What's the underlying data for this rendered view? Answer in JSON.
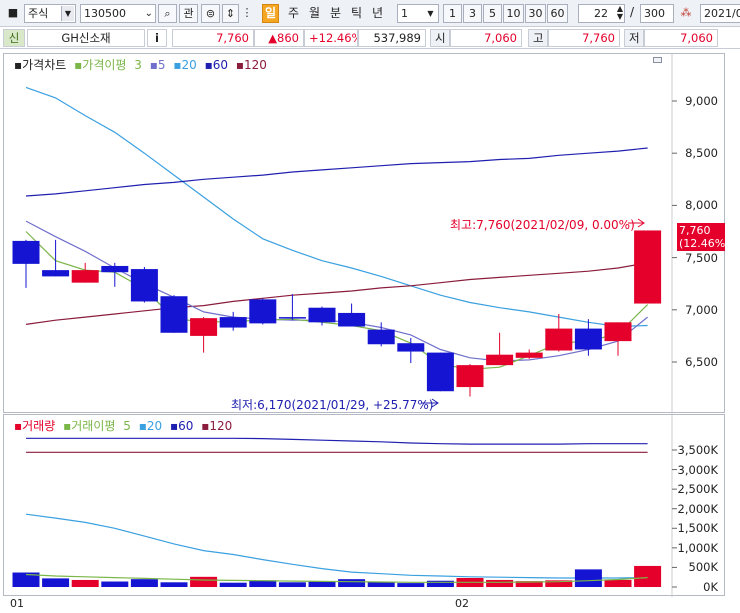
{
  "toolbar": {
    "market_type": "주식",
    "code": "130500",
    "btn_gwan": "관",
    "periods": [
      "일",
      "주",
      "월",
      "분",
      "틱",
      "년"
    ],
    "active_period": "일",
    "interval_value": "1",
    "interval_presets": [
      "1",
      "3",
      "5",
      "10",
      "30",
      "60"
    ],
    "view_count": "22",
    "total_count": "300",
    "slash": "/",
    "date": "2021/0"
  },
  "info": {
    "credit_badge": "신",
    "stock_name": "GH신소재",
    "info_button": "i",
    "price": "7,760",
    "change": "▲860",
    "change_rate": "+12.46%",
    "volume": "537,989",
    "open_label": "시",
    "open": "7,060",
    "high_label": "고",
    "high": "7,760",
    "low_label": "저",
    "low": "7,060"
  },
  "price_panel": {
    "legend_title": "가격차트",
    "ma_label": "가격이평",
    "ma_periods": [
      "3",
      "5",
      "20",
      "60",
      "120"
    ],
    "price_ticks": [
      "9,000",
      "8,500",
      "8,000",
      "7,500",
      "7,000",
      "6,500"
    ],
    "current_price_tag": "7,760",
    "current_rate_tag": "(12.46%)",
    "max_annotation": "최고:7,760(2021/02/09, 0.00%)",
    "min_annotation": "최저:6,170(2021/01/29, +25.77%)"
  },
  "volume_panel": {
    "legend_title": "거래량",
    "ma_label": "거래이평",
    "ma_periods": [
      "5",
      "20",
      "60",
      "120"
    ],
    "volume_ticks": [
      "3,500K",
      "3,000K",
      "2,500K",
      "2,000K",
      "1,500K",
      "1,000K",
      "500K",
      "0K"
    ]
  },
  "xaxis": {
    "labels": [
      "01",
      "02"
    ]
  },
  "colors": {
    "up": "#e4002b",
    "down": "#1414d2",
    "ma3": "#7ab648",
    "ma5": "#7070cc",
    "ma20": "#3aa0e0",
    "ma60": "#2020b0",
    "ma120": "#8a1c3c",
    "active_tab": "#f5a623"
  },
  "chart_data": {
    "type": "candlestick",
    "candles": [
      {
        "o": 7660,
        "h": 7670,
        "l": 7210,
        "c": 7440
      },
      {
        "o": 7380,
        "h": 7670,
        "l": 7320,
        "c": 7320
      },
      {
        "o": 7260,
        "h": 7450,
        "l": 7260,
        "c": 7380
      },
      {
        "o": 7420,
        "h": 7450,
        "l": 7220,
        "c": 7360
      },
      {
        "o": 7390,
        "h": 7410,
        "l": 7070,
        "c": 7080
      },
      {
        "o": 7130,
        "h": 7140,
        "l": 6780,
        "c": 6780
      },
      {
        "o": 6750,
        "h": 6930,
        "l": 6590,
        "c": 6920
      },
      {
        "o": 6930,
        "h": 6980,
        "l": 6800,
        "c": 6830
      },
      {
        "o": 7100,
        "h": 7110,
        "l": 6860,
        "c": 6870
      },
      {
        "o": 6930,
        "h": 7150,
        "l": 6900,
        "c": 6920
      },
      {
        "o": 7020,
        "h": 7030,
        "l": 6850,
        "c": 6880
      },
      {
        "o": 6970,
        "h": 7060,
        "l": 6840,
        "c": 6840
      },
      {
        "o": 6810,
        "h": 6880,
        "l": 6650,
        "c": 6670
      },
      {
        "o": 6680,
        "h": 6730,
        "l": 6490,
        "c": 6600
      },
      {
        "o": 6590,
        "h": 6590,
        "l": 6220,
        "c": 6220
      },
      {
        "o": 6260,
        "h": 6480,
        "l": 6170,
        "c": 6470
      },
      {
        "o": 6470,
        "h": 6780,
        "l": 6470,
        "c": 6570
      },
      {
        "o": 6540,
        "h": 6620,
        "l": 6530,
        "c": 6590
      },
      {
        "o": 6610,
        "h": 6960,
        "l": 6600,
        "c": 6820
      },
      {
        "o": 6820,
        "h": 6910,
        "l": 6560,
        "c": 6620
      },
      {
        "o": 6700,
        "h": 6880,
        "l": 6560,
        "c": 6880
      },
      {
        "o": 7060,
        "h": 7760,
        "l": 7060,
        "c": 7760
      }
    ],
    "volume": [
      370,
      220,
      180,
      140,
      200,
      120,
      260,
      110,
      170,
      120,
      140,
      200,
      130,
      100,
      160,
      230,
      180,
      150,
      170,
      450,
      180,
      537.989
    ],
    "ma3": [
      7750,
      7470,
      7380,
      7360,
      7200,
      6920,
      6880,
      6890,
      6900,
      6910,
      6880,
      6850,
      6800,
      6680,
      6480,
      6430,
      6450,
      6560,
      6680,
      6700,
      6770,
      7050
    ],
    "ma5": [
      7850,
      7700,
      7560,
      7400,
      7250,
      7120,
      6980,
      6930,
      6910,
      6900,
      6900,
      6880,
      6830,
      6760,
      6620,
      6540,
      6510,
      6520,
      6560,
      6620,
      6700,
      6930
    ],
    "ma20": [
      9130,
      9030,
      8860,
      8700,
      8500,
      8290,
      8080,
      7870,
      7680,
      7570,
      7470,
      7400,
      7320,
      7230,
      7140,
      7070,
      7020,
      6980,
      6930,
      6880,
      6840,
      6850
    ],
    "ma60": [
      8090,
      8110,
      8140,
      8170,
      8200,
      8220,
      8250,
      8270,
      8290,
      8320,
      8340,
      8360,
      8380,
      8400,
      8410,
      8420,
      8440,
      8450,
      8480,
      8500,
      8520,
      8550
    ],
    "ma120": [
      6860,
      6900,
      6930,
      6960,
      6990,
      7020,
      7040,
      7080,
      7110,
      7140,
      7160,
      7180,
      7210,
      7230,
      7260,
      7290,
      7310,
      7330,
      7350,
      7370,
      7400,
      7450
    ],
    "vma5": [
      80,
      70,
      65,
      60,
      55,
      50,
      45,
      42,
      40,
      38,
      36,
      34,
      32,
      30,
      30,
      30,
      30,
      32,
      34,
      40,
      48,
      60
    ],
    "vma20": [
      1860,
      1760,
      1650,
      1500,
      1300,
      1100,
      930,
      830,
      700,
      580,
      470,
      380,
      340,
      300,
      280,
      260,
      250,
      240,
      230,
      230,
      230,
      240
    ],
    "vma60": [
      3800,
      3800,
      3800,
      3800,
      3800,
      3800,
      3800,
      3800,
      3790,
      3770,
      3750,
      3730,
      3710,
      3680,
      3660,
      3650,
      3650,
      3650,
      3650,
      3660,
      3660,
      3660
    ],
    "vma120": [
      3440,
      3440,
      3440,
      3440,
      3440,
      3440,
      3440,
      3440,
      3440,
      3440,
      3440,
      3440,
      3440,
      3440,
      3440,
      3440,
      3440,
      3440,
      3440,
      3440,
      3440,
      3440
    ],
    "price_ylim": [
      6170,
      9100
    ],
    "volume_ylim": [
      0,
      3900
    ],
    "grid": false
  }
}
